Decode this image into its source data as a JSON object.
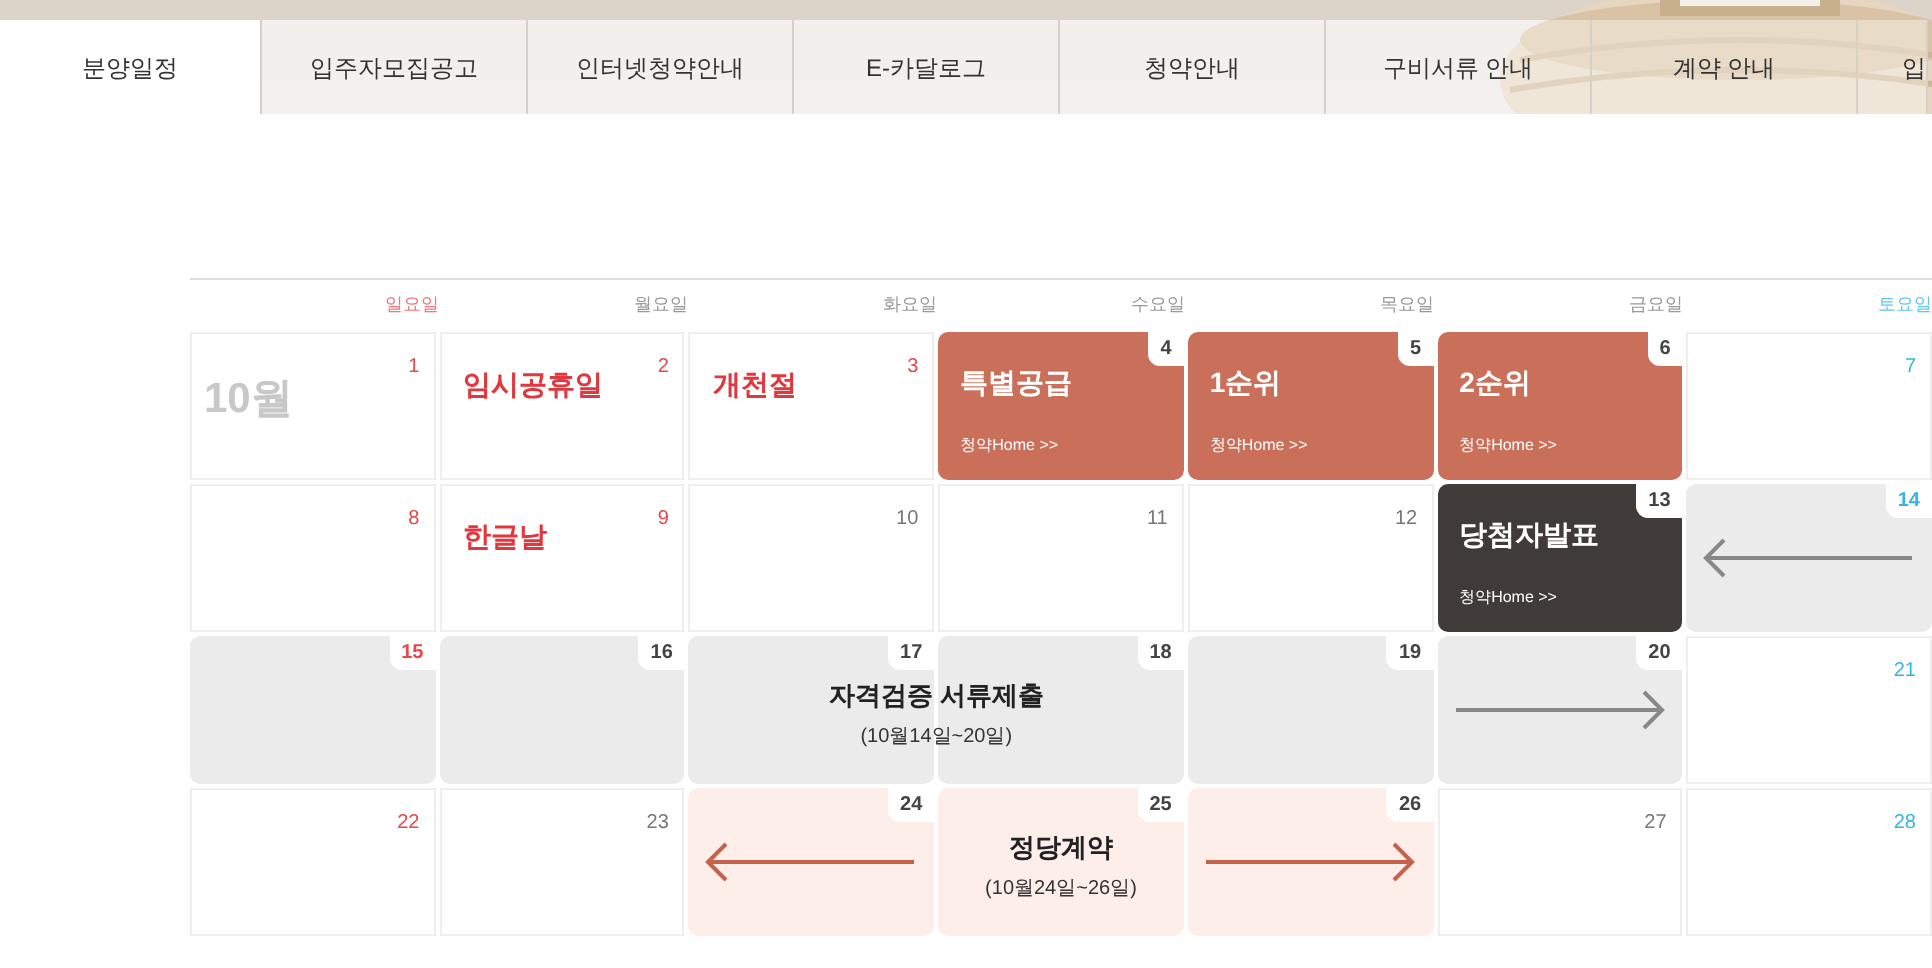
{
  "tabs": [
    {
      "label": "분양일정",
      "selected": true
    },
    {
      "label": "입주자모집공고",
      "selected": false
    },
    {
      "label": "인터넷청약안내",
      "selected": false
    },
    {
      "label": "E-카달로그",
      "selected": false
    },
    {
      "label": "청약안내",
      "selected": false
    },
    {
      "label": "구비서류 안내",
      "selected": false
    },
    {
      "label": "계약 안내",
      "selected": false
    },
    {
      "label": "입",
      "selected": false
    }
  ],
  "calendar": {
    "weekdays": [
      {
        "label": "일요일",
        "kind": "sun"
      },
      {
        "label": "월요일",
        "kind": "weekday"
      },
      {
        "label": "화요일",
        "kind": "weekday"
      },
      {
        "label": "수요일",
        "kind": "weekday"
      },
      {
        "label": "목요일",
        "kind": "weekday"
      },
      {
        "label": "금요일",
        "kind": "weekday"
      },
      {
        "label": "토요일",
        "kind": "sat"
      }
    ],
    "weeks": [
      [
        {
          "day": "1",
          "kind": "plain",
          "month": "10월"
        },
        {
          "day": "2",
          "holiday": true,
          "kind": "holiday",
          "title": "임시공휴일"
        },
        {
          "day": "3",
          "holiday": true,
          "kind": "holiday",
          "title": "개천절"
        },
        {
          "day": "4",
          "holiday": false,
          "kind": "event",
          "title": "특별공급",
          "link": "청약Home >>"
        },
        {
          "day": "5",
          "holiday": false,
          "kind": "event",
          "title": "1순위",
          "link": "청약Home >>"
        },
        {
          "day": "6",
          "holiday": false,
          "kind": "event",
          "title": "2순위",
          "link": "청약Home >>"
        },
        {
          "day": "7",
          "holiday": false,
          "kind": "plain"
        }
      ],
      [
        {
          "day": "8",
          "kind": "plain"
        },
        {
          "day": "9",
          "holiday": true,
          "kind": "holiday",
          "title": "한글날"
        },
        {
          "day": "10",
          "holiday": false,
          "kind": "plain"
        },
        {
          "day": "11",
          "holiday": false,
          "kind": "plain"
        },
        {
          "day": "12",
          "holiday": false,
          "kind": "plain"
        },
        {
          "day": "13",
          "holiday": false,
          "kind": "announce",
          "title": "당첨자발표",
          "link": "청약Home >>"
        },
        {
          "day": "14",
          "holiday": false,
          "kind": "range",
          "arrow": {
            "kind": "left"
          }
        }
      ],
      [
        {
          "day": "15",
          "kind": "range"
        },
        {
          "day": "16",
          "holiday": false,
          "kind": "range"
        },
        {
          "day": "17",
          "holiday": false,
          "kind": "range",
          "label": {
            "title": "자격검증 서류제출",
            "dates": "(10월14일~20일)",
            "across": true
          }
        },
        {
          "day": "18",
          "holiday": false,
          "kind": "range"
        },
        {
          "day": "19",
          "holiday": false,
          "kind": "range"
        },
        {
          "day": "20",
          "holiday": false,
          "kind": "range",
          "arrow": {
            "kind": "right"
          }
        },
        {
          "day": "21",
          "holiday": false,
          "kind": "plain"
        }
      ],
      [
        {
          "day": "22",
          "kind": "plain"
        },
        {
          "day": "23",
          "holiday": false,
          "kind": "plain"
        },
        {
          "day": "24",
          "holiday": false,
          "kind": "contract",
          "arrow": {
            "kind": "left"
          }
        },
        {
          "day": "25",
          "holiday": false,
          "kind": "contract",
          "label": {
            "title": "정당계약",
            "dates": "(10월24일~26일)",
            "across": false
          }
        },
        {
          "day": "26",
          "holiday": false,
          "kind": "contract",
          "arrow": {
            "kind": "right"
          }
        },
        {
          "day": "27",
          "holiday": false,
          "kind": "plain"
        },
        {
          "day": "28",
          "holiday": false,
          "kind": "plain"
        }
      ]
    ]
  }
}
